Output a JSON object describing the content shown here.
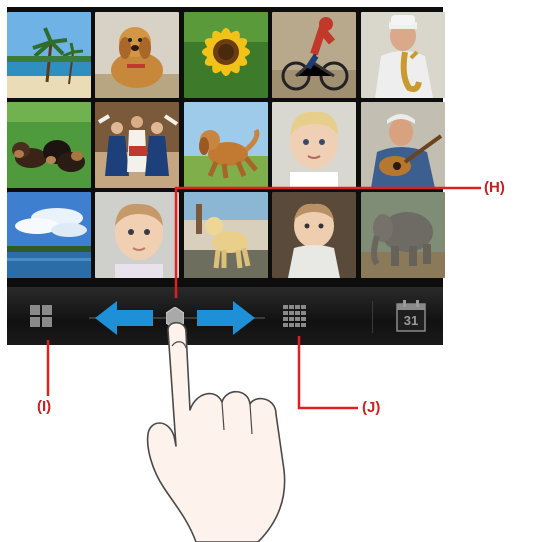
{
  "photos": [
    {
      "subject": "beach-palm-trees"
    },
    {
      "subject": "golden-retriever-dog"
    },
    {
      "subject": "sunflower"
    },
    {
      "subject": "bmx-rider"
    },
    {
      "subject": "man-with-saxophone"
    },
    {
      "subject": "dogs-on-grass"
    },
    {
      "subject": "folk-dancers"
    },
    {
      "subject": "dog-running-on-field"
    },
    {
      "subject": "blond-toddler"
    },
    {
      "subject": "man-with-guitar"
    },
    {
      "subject": "sky-and-lake"
    },
    {
      "subject": "baby-portrait"
    },
    {
      "subject": "yellow-labrador"
    },
    {
      "subject": "baby-in-chair"
    },
    {
      "subject": "elephants"
    }
  ],
  "toolbar": {
    "left_icon": "grid-4-icon",
    "right_icon": "grid-16-icon",
    "calendar_icon": "calendar-icon",
    "calendar_day": "31",
    "slider_arrows": [
      "left-arrow-icon",
      "right-arrow-icon"
    ],
    "arrow_color": "#1e90d8"
  },
  "callouts": {
    "h": "(H)",
    "i": "(I)",
    "j": "(J)"
  },
  "colors": {
    "callout_red": "#cc1f1f",
    "screen_bg": "#0d0d0d"
  }
}
